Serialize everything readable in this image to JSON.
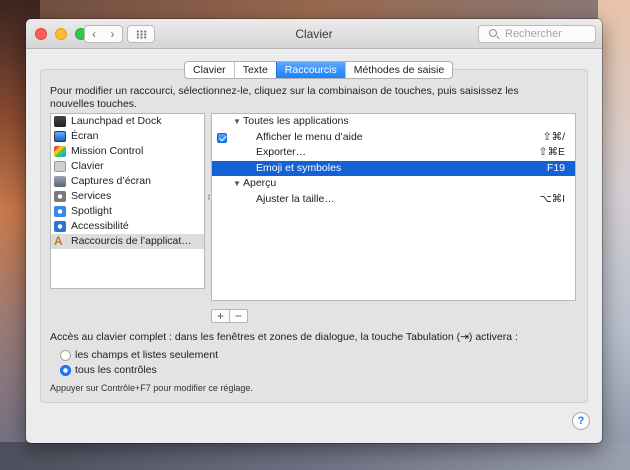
{
  "window": {
    "title": "Clavier",
    "nav_back": "‹",
    "nav_forward": "›",
    "search_placeholder": "Rechercher"
  },
  "tabs": [
    {
      "label": "Clavier",
      "active": false
    },
    {
      "label": "Texte",
      "active": false
    },
    {
      "label": "Raccourcis",
      "active": true
    },
    {
      "label": "Méthodes de saisie",
      "active": false
    }
  ],
  "instructions": "Pour modifier un raccourci, sélectionnez-le, cliquez sur la combinaison de touches, puis saisissez les nouvelles touches.",
  "categories": [
    {
      "label": "Launchpad et Dock",
      "icon": "launchpad-icon"
    },
    {
      "label": "Écran",
      "icon": "display-icon"
    },
    {
      "label": "Mission Control",
      "icon": "mission-control-icon"
    },
    {
      "label": "Clavier",
      "icon": "keyboard-icon"
    },
    {
      "label": "Captures d’écran",
      "icon": "screenshot-icon"
    },
    {
      "label": "Services",
      "icon": "gear-icon"
    },
    {
      "label": "Spotlight",
      "icon": "spotlight-icon"
    },
    {
      "label": "Accessibilité",
      "icon": "accessibility-icon"
    },
    {
      "label": "Raccourcis de l’applicat…",
      "icon": "app-shortcuts-icon",
      "selected": true
    }
  ],
  "shortcuts": {
    "group1": "Toutes les applications",
    "row1_label": "Afficher le menu d’aide",
    "row1_key": "⇧⌘/",
    "row2_label": "Exporter…",
    "row2_key": "⇧⌘E",
    "row3_label": "Emoji et symboles",
    "row3_key": "F19",
    "group2": "Aperçu",
    "row4_label": "Ajuster la taille…",
    "row4_key": "⌥⌘I",
    "disclosure": "▼"
  },
  "buttons": {
    "add": "+",
    "remove": "−",
    "help": "?"
  },
  "access": {
    "text": "Accès au clavier complet : dans les fenêtres et zones de dialogue, la touche Tabulation (⇥) activera :",
    "option1": "les champs et listes seulement",
    "option2": "tous les contrôles",
    "selected": "tous les contrôles",
    "hint": "Appuyer sur Contrôle+F7 pour modifier ce réglage."
  },
  "colors": {
    "accent": "#1b7ef8",
    "selection": "#1262d6"
  }
}
